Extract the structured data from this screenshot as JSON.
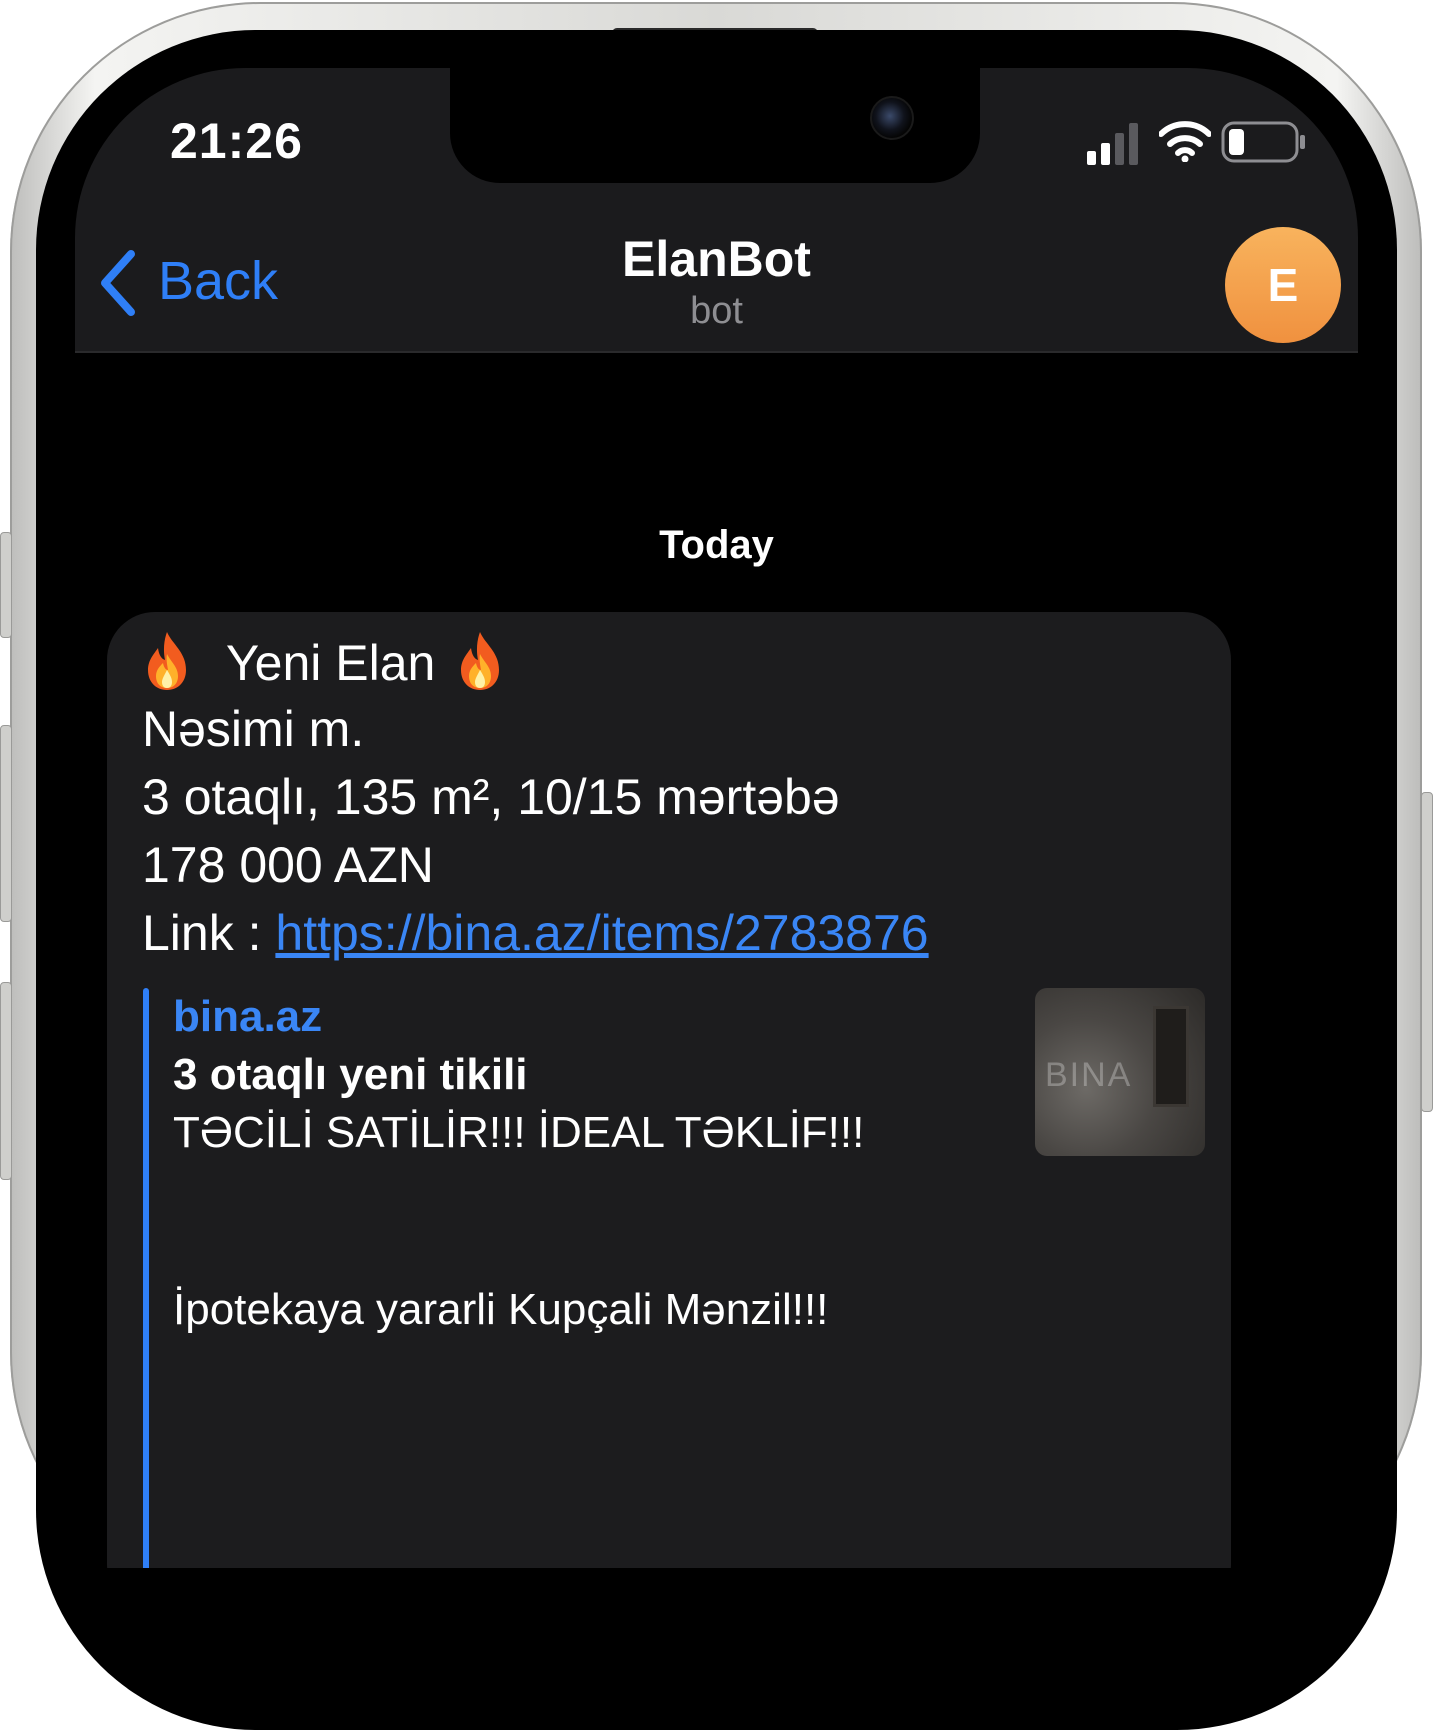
{
  "status_bar": {
    "time": "21:26"
  },
  "header": {
    "back_label": "Back",
    "title": "ElanBot",
    "subtitle": "bot",
    "avatar_letter": "E",
    "avatar_color": "#f39a45"
  },
  "chat": {
    "date_separator": "Today",
    "message": {
      "headline": "Yeni Elan",
      "line_location": "Nəsimi m.",
      "line_details": "3 otaqlı, 135 m², 10/15 mərtəbə",
      "line_price": "178 000 AZN",
      "link_prefix": "Link : ",
      "link_url": "https://bina.az/items/2783876",
      "preview": {
        "site_name": "bina.az",
        "title": "3 otaqlı yeni tikili",
        "description_line1": "TƏCİLİ SATİLİR!!!  İDEAL TƏKLİF!!!",
        "description_line2": "İpotekaya yararli Kupçali Mənzil!!!",
        "thumbnail_watermark": "BINA"
      }
    }
  },
  "colors": {
    "accent": "#2f7ff7",
    "link": "#3a86f5",
    "nav_bg": "#1b1b1d",
    "bubble_bg": "#1c1c1e"
  }
}
